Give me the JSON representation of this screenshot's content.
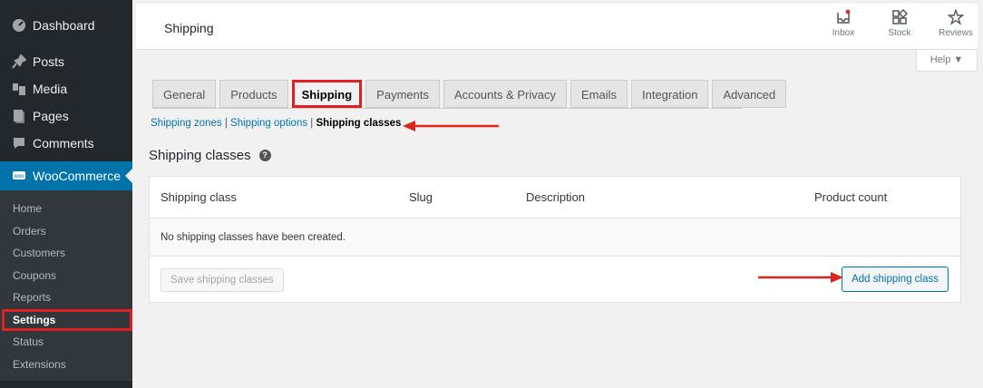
{
  "sidebar": {
    "items": [
      {
        "label": "Dashboard",
        "icon": "dashboard-icon"
      },
      {
        "label": "Posts",
        "icon": "pin-icon"
      },
      {
        "label": "Media",
        "icon": "media-icon"
      },
      {
        "label": "Pages",
        "icon": "pages-icon"
      },
      {
        "label": "Comments",
        "icon": "comment-icon"
      }
    ],
    "woocommerce": {
      "label": "WooCommerce",
      "badge": "woo"
    },
    "submenu": [
      "Home",
      "Orders",
      "Customers",
      "Coupons",
      "Reports",
      "Settings",
      "Status",
      "Extensions"
    ],
    "active_submenu": "Settings"
  },
  "header": {
    "title": "Shipping",
    "actions": [
      {
        "label": "Inbox",
        "icon": "inbox-icon"
      },
      {
        "label": "Stock",
        "icon": "stock-icon"
      },
      {
        "label": "Reviews",
        "icon": "star-icon"
      }
    ],
    "help_label": "Help ▼"
  },
  "tabs": [
    "General",
    "Products",
    "Shipping",
    "Payments",
    "Accounts & Privacy",
    "Emails",
    "Integration",
    "Advanced"
  ],
  "active_tab": "Shipping",
  "subnav": {
    "zones": "Shipping zones",
    "sep1": " | ",
    "options": "Shipping options",
    "sep2": " | ",
    "classes": "Shipping classes"
  },
  "section": {
    "title": "Shipping classes",
    "help_glyph": "?"
  },
  "table": {
    "headers": [
      "Shipping class",
      "Slug",
      "Description",
      "Product count"
    ],
    "empty_message": "No shipping classes have been created."
  },
  "buttons": {
    "save": "Save shipping classes",
    "add": "Add shipping class"
  },
  "colors": {
    "sidebar_bg": "#23282d",
    "accent": "#0073aa",
    "highlight": "#e02121"
  }
}
